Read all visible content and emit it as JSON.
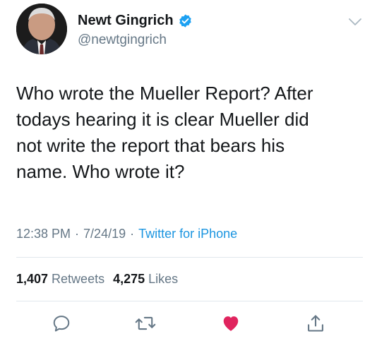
{
  "author": {
    "name": "Newt Gingrich",
    "handle": "@newtgingrich",
    "verified": true
  },
  "tweet": {
    "text_lines": [
      "Who wrote the Mueller Report? After",
      "todays hearing it is clear Mueller did",
      "not write the report that bears his",
      "name. Who wrote it?"
    ],
    "time": "12:38 PM",
    "date": "7/24/19",
    "separator": "·",
    "source": "Twitter for iPhone"
  },
  "stats": {
    "retweets_count": "1,407",
    "retweets_label": "Retweets",
    "likes_count": "4,275",
    "likes_label": "Likes"
  },
  "actions": {
    "reply": "reply-icon",
    "retweet": "retweet-icon",
    "like": "heart-icon",
    "share": "share-icon"
  },
  "colors": {
    "link": "#1b95e0",
    "muted": "#657786",
    "like_active": "#e0245e",
    "verified": "#1da1f2"
  }
}
